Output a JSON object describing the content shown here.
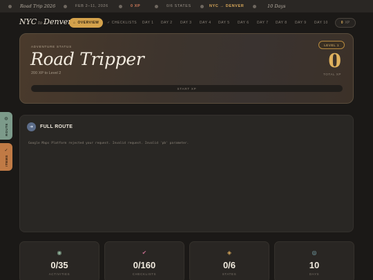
{
  "topbar": {
    "trip_name": "Road Trip 2026",
    "dates": "FEB 2–11, 2026",
    "xp": "0 XP",
    "states": "0/6 STATES",
    "route": "NYC → DENVER",
    "days": "10 Days"
  },
  "nav": {
    "brand_from": "NYC",
    "brand_to_word": "to",
    "brand_to": "Denver",
    "tabs": [
      {
        "label": "Overview",
        "icon": "home-icon"
      },
      {
        "label": "Checklists",
        "icon": "check-icon"
      },
      {
        "label": "Day 1"
      },
      {
        "label": "Day 2"
      },
      {
        "label": "Day 3"
      },
      {
        "label": "Day 4"
      },
      {
        "label": "Day 5"
      },
      {
        "label": "Day 6"
      },
      {
        "label": "Day 7"
      },
      {
        "label": "Day 8"
      },
      {
        "label": "Day 9"
      },
      {
        "label": "Day 10"
      }
    ],
    "xp_value": "0",
    "xp_unit": "XP"
  },
  "hero": {
    "kicker": "ADVENTURE STATUS",
    "title": "Road Tripper",
    "subtitle": "200 XP to Level 2",
    "level": "LEVEL 1",
    "total_xp": "0",
    "total_xp_label": "TOTAL XP",
    "progress_label": "START XP",
    "progress_fraction": 0,
    "accent": "#e0b25e"
  },
  "sidetabs": {
    "route": "ROUTE",
    "items": "ITEMS"
  },
  "route_panel": {
    "title": "FULL ROUTE",
    "icon": "arrow-icon",
    "message": "Google Maps Platform rejected your request. Invalid request. Invalid 'pb' parameter."
  },
  "stats": [
    {
      "value": "0/35",
      "label": "ACTIVITIES",
      "icon": "circle-dot-icon",
      "color": "#8fb39b"
    },
    {
      "value": "0/160",
      "label": "CHECKLISTS",
      "icon": "check-icon",
      "color": "#c06a8a"
    },
    {
      "value": "0/6",
      "label": "STATES",
      "icon": "diamond-icon",
      "color": "#d9a85a"
    },
    {
      "value": "10",
      "label": "DAYS",
      "icon": "target-icon",
      "color": "#7fb0b8"
    }
  ]
}
